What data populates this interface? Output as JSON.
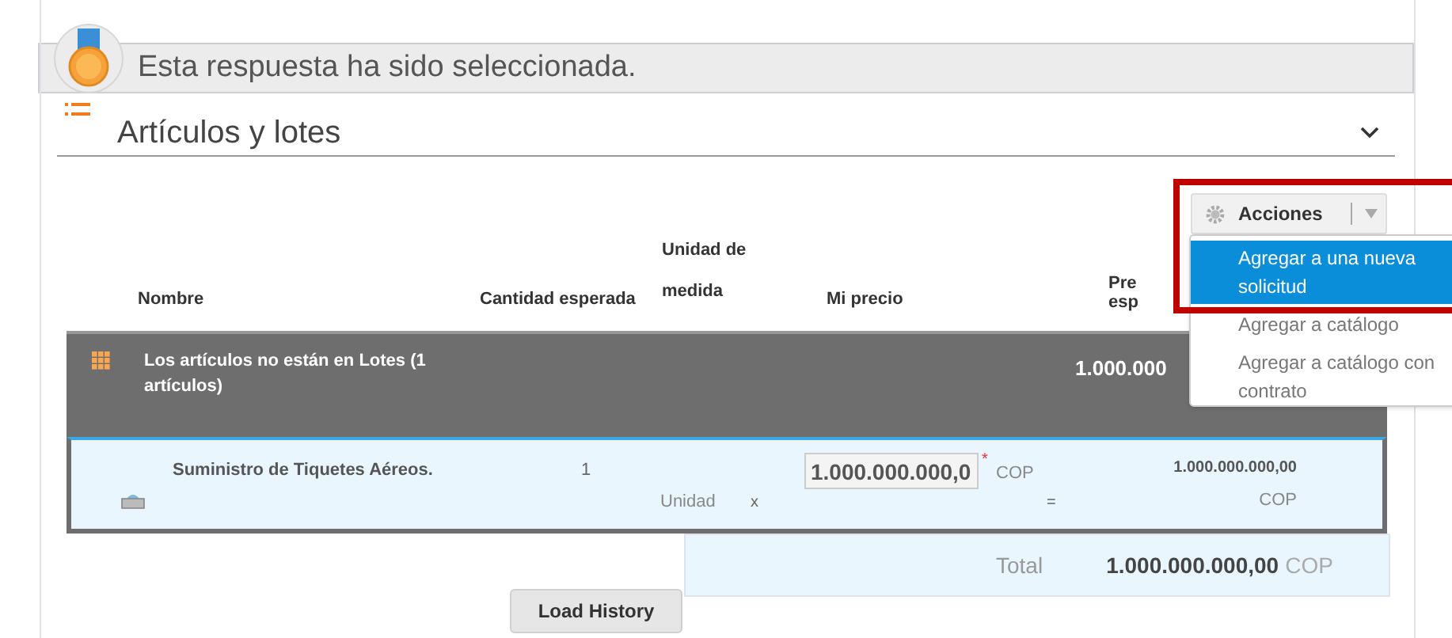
{
  "banner": {
    "text": "Esta respuesta ha sido seleccionada."
  },
  "section": {
    "title": "Artículos y lotes",
    "expanded": true
  },
  "actions": {
    "label": "Acciones",
    "open": true
  },
  "menu": [
    {
      "label": "Agregar a una nueva solicitud",
      "selected": true
    },
    {
      "label": "Agregar a catálogo",
      "selected": false
    },
    {
      "label": "Agregar a catálogo con contrato",
      "selected": false
    }
  ],
  "table": {
    "columns": [
      "Nombre",
      "Cantidad esperada",
      "Unidad de medida",
      "Mi precio",
      "Pre esp"
    ],
    "group": {
      "label": "Los artículos no están en Lotes (1 artículos)",
      "total": "1.000.000"
    },
    "rows": [
      {
        "name": "Suministro de Tiquetes Aéreos.",
        "quantity": "1",
        "unit": "Unidad",
        "times": "x",
        "price": "1.000.000.000,0",
        "required": "*",
        "currency": "COP",
        "equals": "=",
        "total": "1.000.000.000,00",
        "total_currency": "COP"
      }
    ],
    "footer": {
      "label": "Total",
      "amount": "1.000.000.000,00",
      "currency": "COP"
    }
  },
  "load_button": "Load History"
}
